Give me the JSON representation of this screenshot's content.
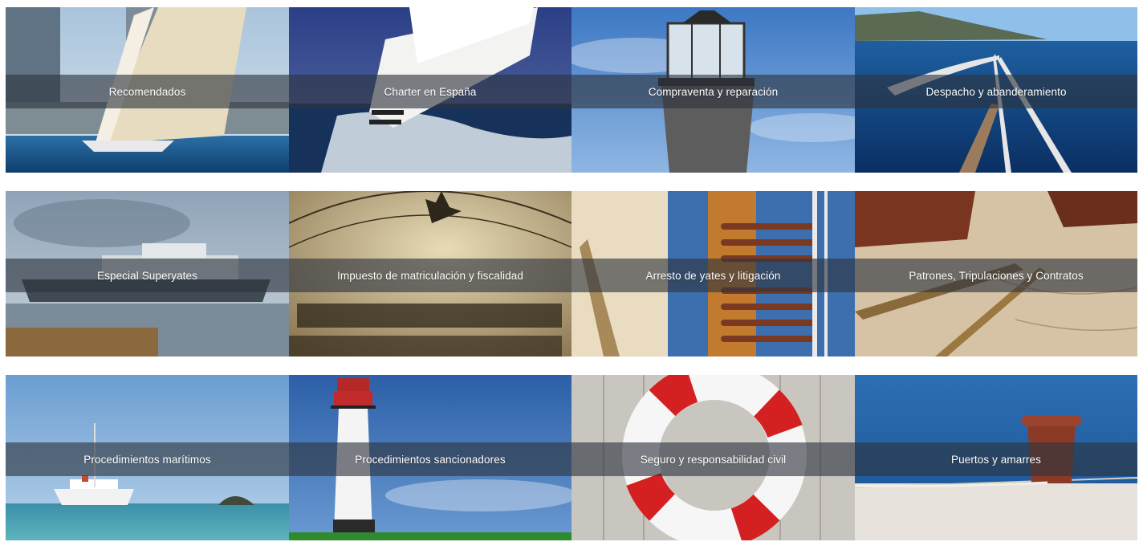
{
  "tiles": [
    {
      "id": "recomendados",
      "label": "Recomendados",
      "icon": "sailboat-regatta-image"
    },
    {
      "id": "charter",
      "label": "Charter en España",
      "icon": "sailing-hull-waves-image"
    },
    {
      "id": "compraventa",
      "label": "Compraventa y reparación",
      "icon": "lighthouse-lantern-image"
    },
    {
      "id": "despacho",
      "label": "Despacho y abanderamiento",
      "icon": "bow-pulpit-sea-image"
    },
    {
      "id": "superyates",
      "label": "Especial Superyates",
      "icon": "superyacht-harbor-image"
    },
    {
      "id": "impuesto",
      "label": "Impuesto de matriculación y fiscalidad",
      "icon": "barometer-dial-image"
    },
    {
      "id": "arresto",
      "label": "Arresto de yates y litigación",
      "icon": "rigging-ropes-image"
    },
    {
      "id": "patrones",
      "label": "Patrones, Tripulaciones y Contratos",
      "icon": "nautical-chart-dividers-image"
    },
    {
      "id": "maritimos",
      "label": "Procedimientos marítimos",
      "icon": "white-boat-sea-image"
    },
    {
      "id": "sancionadores",
      "label": "Procedimientos sancionadores",
      "icon": "white-lighthouse-image"
    },
    {
      "id": "seguro",
      "label": "Seguro y responsabilidad civil",
      "icon": "lifebuoy-image"
    },
    {
      "id": "puertos",
      "label": "Puertos y amarres",
      "icon": "mooring-bollard-image"
    }
  ],
  "colors": {
    "band": "#2d343e",
    "label": "#ffffff",
    "sea": "#1b4f86",
    "sky": "#8fb8dc"
  }
}
